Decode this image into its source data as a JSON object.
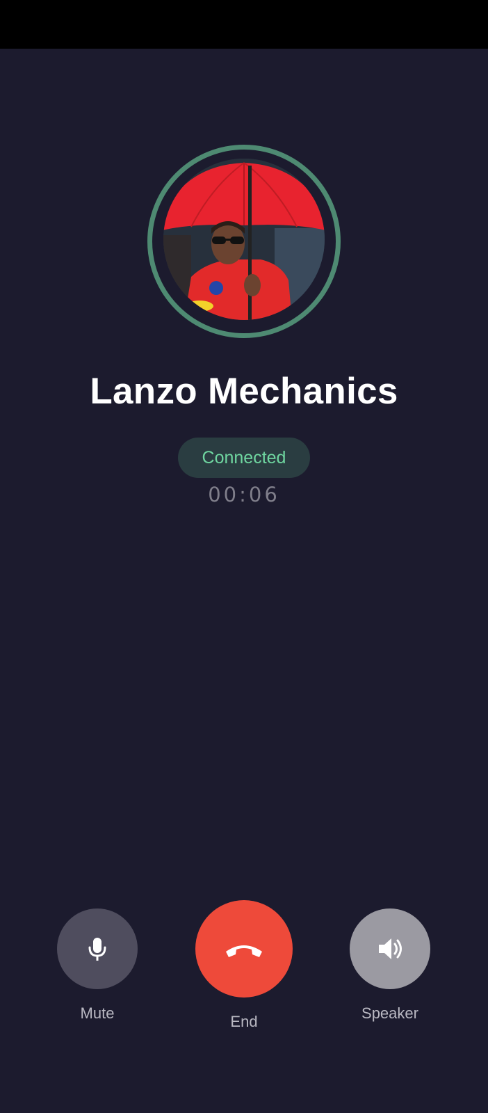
{
  "caller": {
    "name": "Lanzo Mechanics",
    "avatar": "caller-photo"
  },
  "call": {
    "status": "Connected",
    "duration": "00:06"
  },
  "controls": {
    "mute": {
      "label": "Mute",
      "icon": "microphone-icon"
    },
    "end": {
      "label": "End",
      "icon": "hang-up-icon"
    },
    "speaker": {
      "label": "Speaker",
      "icon": "speaker-icon"
    }
  },
  "colors": {
    "background": "#1c1b2e",
    "ring": "#4e8a72",
    "status_text": "#6fd6a0",
    "status_pill": "#2a3d41",
    "end_button": "#ee4a3a",
    "mute_button": "#4f4d5e",
    "speaker_button": "#9b9aa2"
  }
}
